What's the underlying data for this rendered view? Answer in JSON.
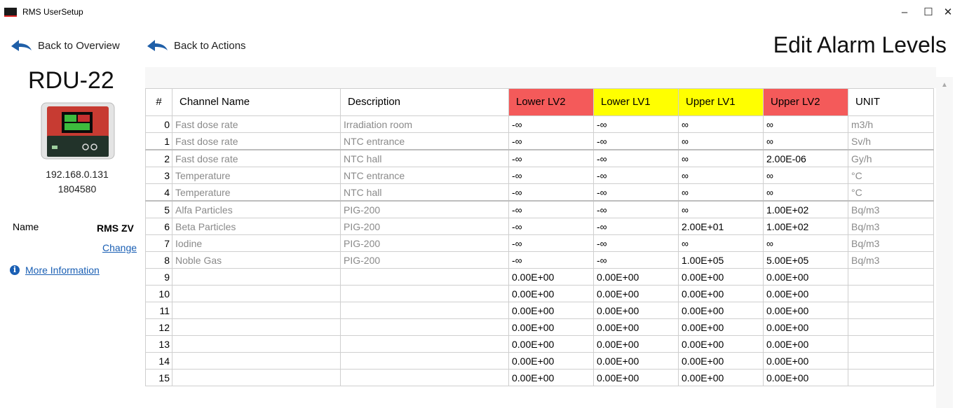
{
  "window": {
    "title": "RMS UserSetup",
    "minimize": "–",
    "maximize": "☐",
    "close": "✕"
  },
  "nav": {
    "back_overview": "Back to Overview",
    "back_actions": "Back to Actions"
  },
  "page_title": "Edit Alarm Levels",
  "device": {
    "name": "RDU-22",
    "ip": "192.168.0.131",
    "serial": "1804580"
  },
  "info": {
    "name_label": "Name",
    "name_value": "RMS ZV",
    "change": "Change",
    "more_info": "More Information",
    "info_glyph": "i"
  },
  "colors": {
    "lv2": "#f45a5a",
    "lv1": "#ffff00",
    "link": "#1a5fb4"
  },
  "table": {
    "headers": [
      "#",
      "Channel Name",
      "Description",
      "Lower LV2",
      "Lower LV1",
      "Upper LV1",
      "Upper LV2",
      "UNIT"
    ],
    "rows": [
      [
        "0",
        "Fast dose rate",
        "Irradiation room",
        "-∞",
        "-∞",
        "∞",
        "∞",
        "m3/h"
      ],
      [
        "1",
        "Fast dose rate",
        "NTC entrance",
        "-∞",
        "-∞",
        "∞",
        "∞",
        "Sv/h"
      ],
      [
        "2",
        "Fast dose rate",
        "NTC hall",
        "-∞",
        "-∞",
        "∞",
        "2.00E-06",
        "Gy/h"
      ],
      [
        "3",
        "Temperature",
        "NTC entrance",
        "-∞",
        "-∞",
        "∞",
        "∞",
        "°C"
      ],
      [
        "4",
        "Temperature",
        "NTC hall",
        "-∞",
        "-∞",
        "∞",
        "∞",
        "°C"
      ],
      [
        "5",
        "Alfa Particles",
        "PIG-200",
        "-∞",
        "-∞",
        "∞",
        "1.00E+02",
        "Bq/m3"
      ],
      [
        "6",
        "Beta Particles",
        "PIG-200",
        "-∞",
        "-∞",
        "2.00E+01",
        "1.00E+02",
        "Bq/m3"
      ],
      [
        "7",
        "Iodine",
        "PIG-200",
        "-∞",
        "-∞",
        "∞",
        "∞",
        "Bq/m3"
      ],
      [
        "8",
        "Noble Gas",
        "PIG-200",
        "-∞",
        "-∞",
        "1.00E+05",
        "5.00E+05",
        "Bq/m3"
      ],
      [
        "9",
        "",
        "",
        "0.00E+00",
        "0.00E+00",
        "0.00E+00",
        "0.00E+00",
        ""
      ],
      [
        "10",
        "",
        "",
        "0.00E+00",
        "0.00E+00",
        "0.00E+00",
        "0.00E+00",
        ""
      ],
      [
        "11",
        "",
        "",
        "0.00E+00",
        "0.00E+00",
        "0.00E+00",
        "0.00E+00",
        ""
      ],
      [
        "12",
        "",
        "",
        "0.00E+00",
        "0.00E+00",
        "0.00E+00",
        "0.00E+00",
        ""
      ],
      [
        "13",
        "",
        "",
        "0.00E+00",
        "0.00E+00",
        "0.00E+00",
        "0.00E+00",
        ""
      ],
      [
        "14",
        "",
        "",
        "0.00E+00",
        "0.00E+00",
        "0.00E+00",
        "0.00E+00",
        ""
      ],
      [
        "15",
        "",
        "",
        "0.00E+00",
        "0.00E+00",
        "0.00E+00",
        "0.00E+00",
        ""
      ]
    ]
  }
}
